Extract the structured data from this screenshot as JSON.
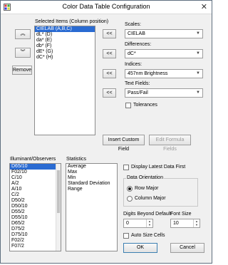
{
  "window": {
    "title": "Color Data Table Configuration",
    "close_glyph": "✕"
  },
  "selected_items": {
    "label": "Selected Items (Column position)",
    "items": [
      "CIELAB (A,B,C)",
      "dL* (D)",
      "da* (E)",
      "db* (F)",
      "dE* (G)",
      "dC* (H)"
    ],
    "selected_index": 0
  },
  "move_buttons": {
    "up": "︽",
    "down": "︾",
    "remove": "Remove"
  },
  "add_buttons": {
    "glyph": "<<"
  },
  "scales": {
    "label": "Scales:",
    "value": "CIELAB"
  },
  "differences": {
    "label": "Differences:",
    "value": "dC*"
  },
  "indices": {
    "label": "Indices:",
    "value": "457nm Brightness"
  },
  "text_fields": {
    "label": "Text Fields:",
    "value": "Pass/Fail"
  },
  "tolerances": {
    "label": "Tolerances",
    "checked": false
  },
  "insert_custom_field": "Insert Custom Field",
  "edit_formula_fields": "Edit Formula Fields",
  "illuminants": {
    "label": "Illuminant/Observers",
    "items": [
      "D65/10",
      "F02/10",
      "C/10",
      "A/2",
      "A/10",
      "C/2",
      "D50/2",
      "D50/10",
      "D55/2",
      "D55/10",
      "D65/2",
      "D75/2",
      "D75/10",
      "F02/2",
      "F07/2"
    ],
    "selected_index": 0
  },
  "statistics": {
    "label": "Statistics",
    "items": [
      "Average",
      "Max",
      "Min",
      "Standard Deviation",
      "Range"
    ]
  },
  "display_latest": {
    "label": "Display Latest Data First",
    "checked": false
  },
  "data_orientation": {
    "label": "Data Orientation",
    "options": [
      "Row Major",
      "Column Major"
    ],
    "selected": "Row Major"
  },
  "digits": {
    "label": "Digits Beyond Default",
    "value": "0"
  },
  "font_size": {
    "label": "Font Size",
    "value": "10"
  },
  "auto_size": {
    "label": "Auto Size Cells",
    "checked": false
  },
  "ok": "OK",
  "cancel": "Cancel",
  "colors": {
    "selection": "#2a6bd2",
    "default_border": "#3c7fb1"
  }
}
